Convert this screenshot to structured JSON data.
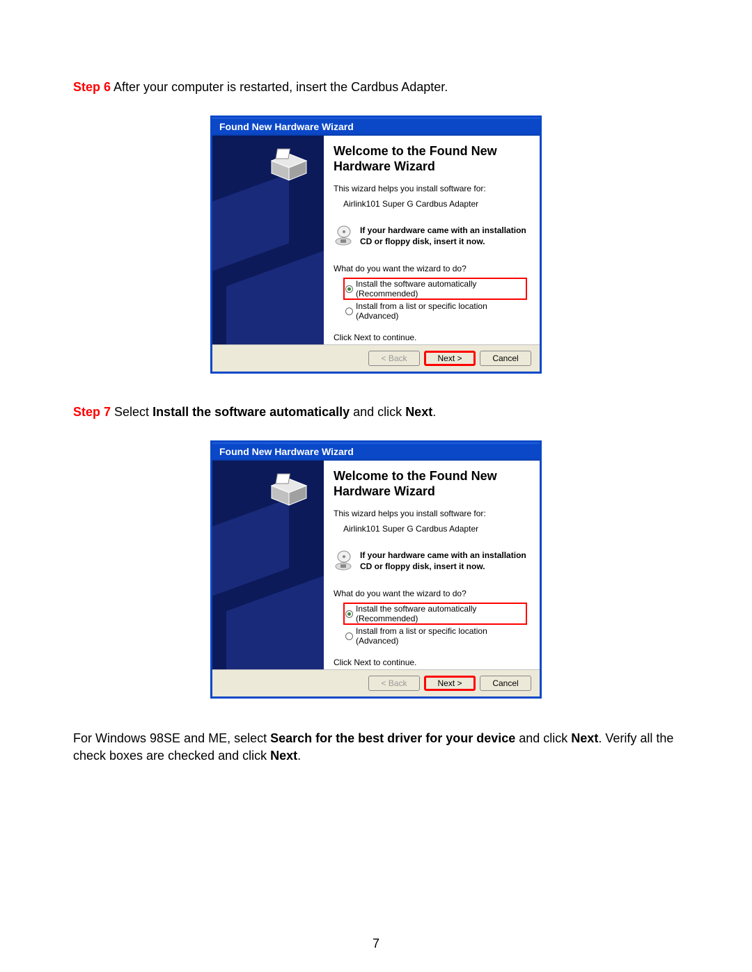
{
  "step6": {
    "label": "Step 6",
    "text": " After your computer is restarted, insert the Cardbus Adapter."
  },
  "step7": {
    "label": "Step 7",
    "before": " Select ",
    "bold1": "Install the software automatically",
    "mid": " and click ",
    "bold2": "Next",
    "after": "."
  },
  "dialog": {
    "title": "Found New Hardware Wizard",
    "heading": "Welcome to the Found New Hardware Wizard",
    "intro": "This wizard helps you install software for:",
    "device": "Airlink101 Super G Cardbus Adapter",
    "cd_notice": "If your hardware came with an installation CD or floppy disk, insert it now.",
    "question": "What do you want the wizard to do?",
    "option1": "Install the software automatically (Recommended)",
    "option2": "Install from a list or specific location (Advanced)",
    "continue": "Click Next to continue.",
    "back": "< Back",
    "next": "Next >",
    "cancel": "Cancel"
  },
  "note": {
    "before": "For Windows 98SE and ME, select ",
    "bold1": "Search for the best driver for your device",
    "mid1": " and click ",
    "bold2": "Next",
    "mid2": ". Verify all the check boxes are checked and click ",
    "bold3": "Next",
    "after": "."
  },
  "page_number": "7"
}
